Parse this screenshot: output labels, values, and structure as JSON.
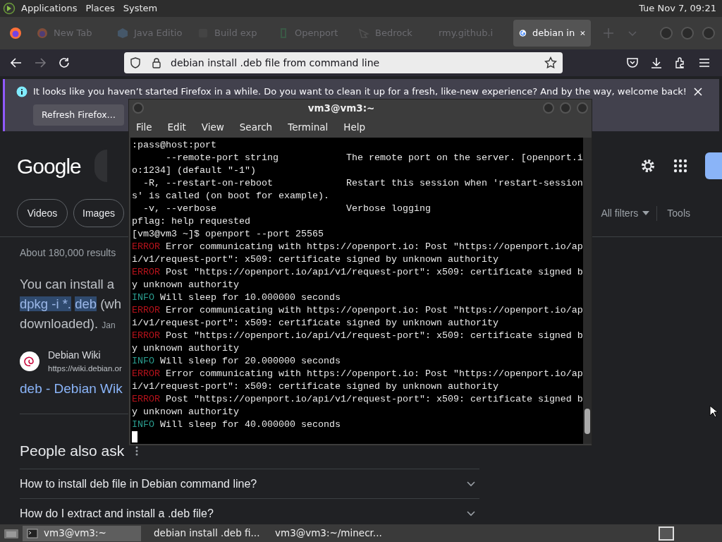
{
  "top_panel": {
    "menus": [
      "Applications",
      "Places",
      "System"
    ],
    "clock": "Tue Nov 7, 09:21"
  },
  "browser": {
    "tabs": [
      {
        "label": "New Tab",
        "selected": false,
        "dimmed": true
      },
      {
        "label": "Java Editio",
        "selected": false,
        "dimmed": true
      },
      {
        "label": "Build exp",
        "selected": false,
        "dimmed": true
      },
      {
        "label": "Openport",
        "selected": false,
        "dimmed": true
      },
      {
        "label": "Bedrock",
        "selected": false,
        "dimmed": true
      },
      {
        "label": "rmy.github.i",
        "selected": false,
        "dimmed": true
      },
      {
        "label": "debian in",
        "selected": true,
        "dimmed": false
      }
    ],
    "address": "debian install .deb file from command line",
    "notification": {
      "message": "It looks like you haven’t started Firefox in a while. Do you want to clean it up for a fresh, like-new experience? And by the way, welcome back!",
      "button": "Refresh Firefox…"
    }
  },
  "google": {
    "logo": "Google",
    "chips": [
      "Videos",
      "Images"
    ],
    "all_filters": "All filters",
    "tools": "Tools",
    "results_count": "About 180,000 results",
    "snippet": [
      [
        {
          "text": "You can install a",
          "highlight": false
        }
      ],
      [
        {
          "text": "dpkg -i *. ",
          "highlight": true
        },
        {
          "text": "deb",
          "highlight": true
        },
        {
          "text": " (wh",
          "highlight": false
        }
      ],
      [
        {
          "text": "downloaded).",
          "highlight": false
        }
      ]
    ],
    "snippet_date": "Jan",
    "source": {
      "site": "Debian Wiki",
      "url": "https://wiki.debian.or",
      "title": "deb - Debian Wik"
    },
    "people_also_ask": {
      "heading": "People also ask",
      "questions": [
        "How to install deb file in Debian command line?",
        "How do I extract and install a .deb file?"
      ]
    }
  },
  "terminal": {
    "title": "vm3@vm3:~",
    "menus": [
      "File",
      "Edit",
      "View",
      "Search",
      "Terminal",
      "Help"
    ],
    "lines": [
      {
        "kind": "plain",
        "text": ":pass@host:port"
      },
      {
        "kind": "plain",
        "text": "      --remote-port string            The remote port on the server. [openport.i"
      },
      {
        "kind": "plain",
        "text": "o:1234] (default \"-1\")"
      },
      {
        "kind": "plain",
        "text": "  -R, --restart-on-reboot             Restart this session when 'restart-session"
      },
      {
        "kind": "plain",
        "text": "s' is called (on boot for example)."
      },
      {
        "kind": "plain",
        "text": "  -v, --verbose                       Verbose logging"
      },
      {
        "kind": "plain",
        "text": "pflag: help requested"
      },
      {
        "kind": "plain",
        "text": "[vm3@vm3 ~]$ openport --port 25565"
      },
      {
        "kind": "error",
        "tag": "ERROR",
        "text": "Error communicating with https://openport.io: Post \"https://openport.io/ap"
      },
      {
        "kind": "plain",
        "text": "i/v1/request-port\": x509: certificate signed by unknown authority"
      },
      {
        "kind": "error",
        "tag": "ERROR",
        "text": "Post \"https://openport.io/api/v1/request-port\": x509: certificate signed b"
      },
      {
        "kind": "plain",
        "text": "y unknown authority"
      },
      {
        "kind": "info",
        "tag": "INFO",
        "text": "Will sleep for 10.000000 seconds"
      },
      {
        "kind": "error",
        "tag": "ERROR",
        "text": "Error communicating with https://openport.io: Post \"https://openport.io/ap"
      },
      {
        "kind": "plain",
        "text": "i/v1/request-port\": x509: certificate signed by unknown authority"
      },
      {
        "kind": "error",
        "tag": "ERROR",
        "text": "Post \"https://openport.io/api/v1/request-port\": x509: certificate signed b"
      },
      {
        "kind": "plain",
        "text": "y unknown authority"
      },
      {
        "kind": "info",
        "tag": "INFO",
        "text": "Will sleep for 20.000000 seconds"
      },
      {
        "kind": "error",
        "tag": "ERROR",
        "text": "Error communicating with https://openport.io: Post \"https://openport.io/ap"
      },
      {
        "kind": "plain",
        "text": "i/v1/request-port\": x509: certificate signed by unknown authority"
      },
      {
        "kind": "error",
        "tag": "ERROR",
        "text": "Post \"https://openport.io/api/v1/request-port\": x509: certificate signed b"
      },
      {
        "kind": "plain",
        "text": "y unknown authority"
      },
      {
        "kind": "info",
        "tag": "INFO",
        "text": "Will sleep for 40.000000 seconds"
      },
      {
        "kind": "cursor"
      }
    ]
  },
  "taskbar": {
    "items": [
      {
        "label": "vm3@vm3:~",
        "selected": true
      },
      {
        "label": "debian install .deb fi...",
        "selected": false
      },
      {
        "label": "vm3@vm3:~/minecr...",
        "selected": false
      }
    ]
  }
}
